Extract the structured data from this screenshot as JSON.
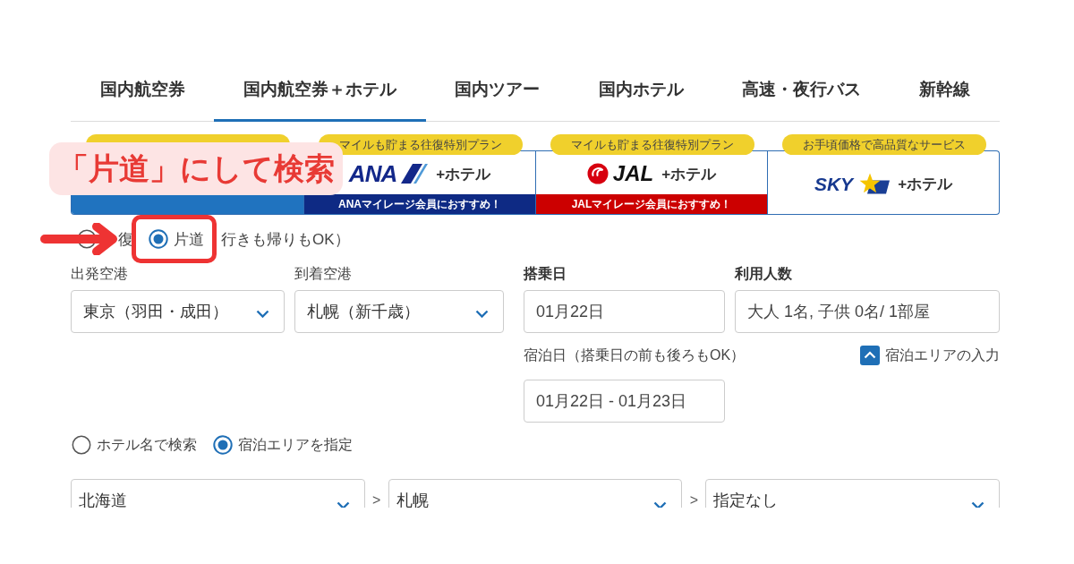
{
  "tabs": [
    {
      "label": "国内航空券",
      "selected": false
    },
    {
      "label": "国内航空券＋ホテル",
      "selected": true
    },
    {
      "label": "国内ツアー",
      "selected": false
    },
    {
      "label": "国内ホテル",
      "selected": false
    },
    {
      "label": "高速・夜行バス",
      "selected": false
    },
    {
      "label": "新幹線",
      "selected": false
    }
  ],
  "plans": [
    {
      "kind": "lcc",
      "color": "#2073bf"
    },
    {
      "kind": "ana",
      "badge": "マイルも貯まる往復特別プラン",
      "logo": "ANA",
      "label": "+ホテル",
      "banner": "ANAマイレージ会員におすすめ！",
      "color": "#0e2a84"
    },
    {
      "kind": "jal",
      "badge": "マイルも貯まる往復特別プラン",
      "logo": "JAL",
      "label": "+ホテル",
      "banner": "JALマイレージ会員におすすめ！",
      "color": "#cc0000"
    },
    {
      "kind": "sky",
      "badge": "お手頃価格で高品質なサービス",
      "logo": "SKY",
      "label": "+ホテル"
    }
  ],
  "annotation": {
    "text": "「片道」にして検索"
  },
  "trip_type": {
    "options": [
      {
        "label": "復",
        "selected": false
      },
      {
        "label": "片道",
        "selected": true
      }
    ],
    "note": "行きも帰りもOK）"
  },
  "flight": {
    "fields": [
      {
        "kind": "select",
        "label": "出発空港",
        "value": "東京（羽田・成田）"
      },
      {
        "kind": "select",
        "label": "到着空港",
        "value": "札幌（新千歳）"
      },
      {
        "kind": "input",
        "label": "搭乗日",
        "value": "01月22日"
      },
      {
        "kind": "input",
        "label": "利用人数",
        "value": "大人 1名, 子供 0名/ 1部屋"
      }
    ]
  },
  "stay": {
    "label": "宿泊日（搭乗日の前も後ろもOK）",
    "value": "01月22日 - 01月23日",
    "area_toggle": {
      "label": "宿泊エリアの入力",
      "expanded": true
    }
  },
  "hotel_search": {
    "options": [
      {
        "label": "ホテル名で検索",
        "selected": false
      },
      {
        "label": "宿泊エリアを指定",
        "selected": true
      }
    ]
  },
  "area": {
    "separator": ">",
    "selects": [
      "北海道",
      "札幌",
      "指定なし"
    ]
  }
}
